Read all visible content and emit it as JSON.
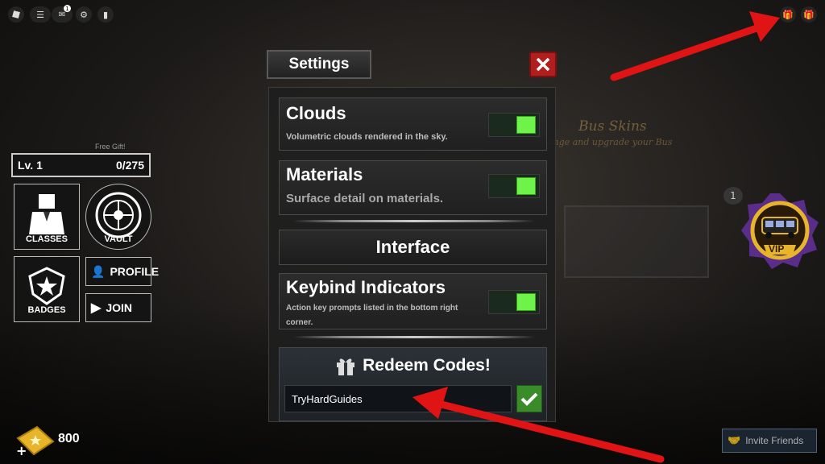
{
  "topbar": {
    "menu_icons": [
      "roblox-icon",
      "hamburger-menu-icon",
      "chat-icon",
      "settings-gear-icon",
      "leaderboard-icon"
    ],
    "right_icons": [
      "gift-icon",
      "gift-icon"
    ],
    "chat_badge": "1"
  },
  "settings": {
    "title": "Settings",
    "rows": [
      {
        "title": "Clouds",
        "desc": "Volumetric clouds rendered in the sky.",
        "enabled": true
      },
      {
        "title": "Materials",
        "desc": "Surface detail on materials.",
        "enabled": true
      },
      {
        "title": "Keybind Indicators",
        "desc": "Action key prompts listed in the bottom right corner.",
        "enabled": true
      }
    ],
    "interface_label": "Interface",
    "redeem": {
      "title": "Redeem Codes!",
      "code_value": "TryHardGuides",
      "confirm_icon": "checkmark-icon"
    }
  },
  "hud": {
    "free_gift": "Free Gift!",
    "level": "Lv. 1",
    "xp": "0/275",
    "classes_label": "CLASSES",
    "vault_label": "VAULT",
    "badges_label": "BADGES",
    "profile_label": "PROFILE",
    "join_label": "JOIN",
    "tickets": "800"
  },
  "background": {
    "bus_skins_title": "Bus Skins",
    "bus_skins_sub": "ange and upgrade your Bus",
    "vip_label": "VIP",
    "stand_count": "1",
    "invite_friends": "Invite Friends"
  },
  "colors": {
    "accent_green": "#6df34a",
    "close_red": "#b11e1e",
    "arrow_red": "#e01414"
  }
}
